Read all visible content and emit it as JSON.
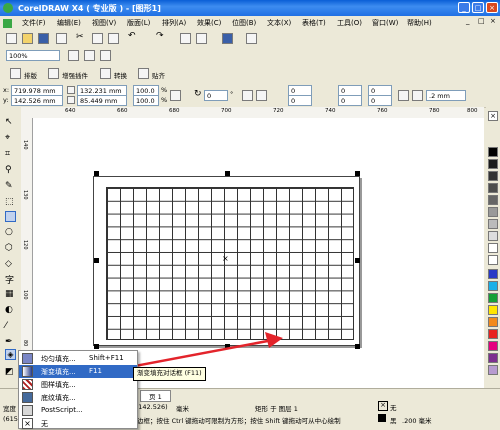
{
  "window": {
    "title": "CorelDRAW X4 ( 专业版 ) - [图形1]",
    "min": "_",
    "max": "□",
    "close": "×",
    "doc_min": "_",
    "doc_max": "□",
    "doc_close": "×"
  },
  "menu": [
    "文件(F)",
    "编辑(E)",
    "视图(V)",
    "版面(L)",
    "排列(A)",
    "效果(C)",
    "位图(B)",
    "文本(X)",
    "表格(T)",
    "工具(O)",
    "窗口(W)",
    "帮助(H)"
  ],
  "toolbar": {
    "zoom": "100%"
  },
  "plugins": {
    "layout": "排版",
    "enhance": "增强插件",
    "convert": "转换",
    "paste": "贴齐"
  },
  "property_bar": {
    "x": "719.978 mm",
    "y": "142.526 mm",
    "width": "132.231 mm",
    "height": "85.449 mm",
    "scale_w": "100.0",
    "scale_h": "100.0",
    "percent": "%",
    "rotation": "0",
    "degree": "°",
    "columns": "0",
    "rows": "0",
    "sp1": "0",
    "sp2": "0",
    "sp3": "0",
    "sp4": "0",
    "outline": ".2 mm"
  },
  "ruler": {
    "h_ticks": [
      "640",
      "660",
      "680",
      "700",
      "720",
      "740",
      "760",
      "780",
      "800"
    ],
    "v_ticks": [
      "140",
      "130",
      "120",
      "100",
      "80"
    ]
  },
  "popup_menu": {
    "items": [
      {
        "label": "均匀填充...",
        "shortcut": "Shift+F11"
      },
      {
        "label": "渐变填充...",
        "shortcut": "F11"
      },
      {
        "label": "图样填充...",
        "shortcut": ""
      },
      {
        "label": "底纹填充...",
        "shortcut": ""
      },
      {
        "label": "PostScript...",
        "shortcut": ""
      },
      {
        "label": "无",
        "shortcut": ""
      }
    ]
  },
  "tooltip": "渐变填充对话框 (F11)",
  "page_tab": "页 1",
  "status": {
    "width_label": "宽度",
    "coords": "(615",
    "coords2": "8, 142.526)",
    "unit": "毫米",
    "object": "矩形 于 图层 1",
    "hint": "边框；按住 Ctrl 键拖动可限制为方形；按住 Shift 键拖动可从中心绘制",
    "fill": "无",
    "outline_color": "黑",
    "outline_width": ".200 毫米"
  },
  "colors": {
    "accent": "#316ac5",
    "titlebar": "#0a5fd6",
    "arrow": "#e3242b"
  }
}
